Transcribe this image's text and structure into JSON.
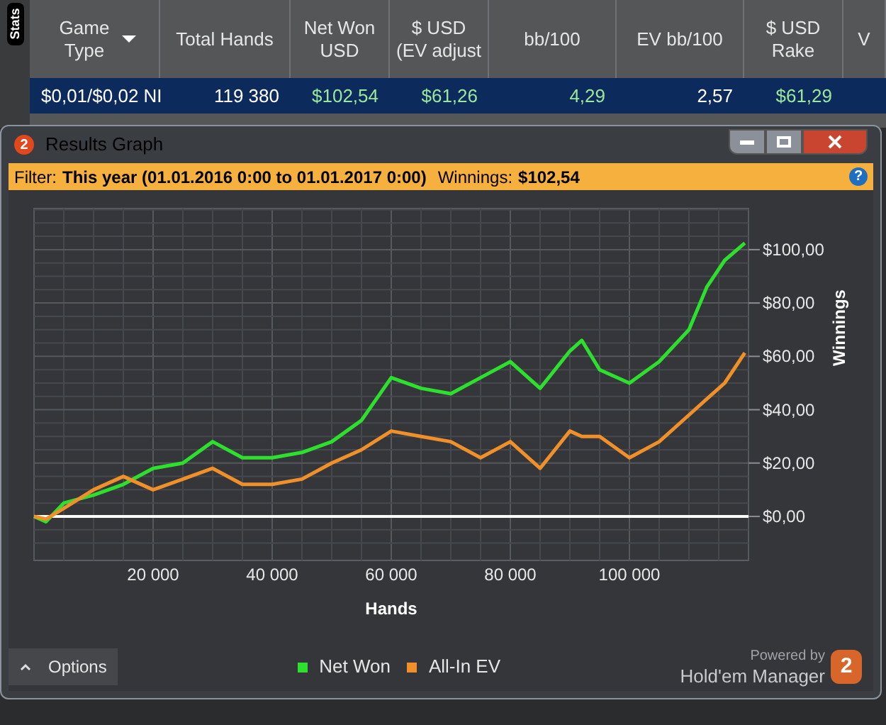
{
  "side_tab": {
    "label": "Stats"
  },
  "table": {
    "columns": [
      {
        "label": "Game Type",
        "menu": true
      },
      {
        "label": "Total Hands",
        "menu": false
      },
      {
        "label": "Net Won USD",
        "menu": false
      },
      {
        "label": "$ USD (EV adjust",
        "menu": false
      },
      {
        "label": "bb/100",
        "menu": false
      },
      {
        "label": "EV bb/100",
        "menu": false
      },
      {
        "label": "$ USD Rake",
        "menu": false
      },
      {
        "label": "V",
        "menu": false
      }
    ],
    "rows": [
      {
        "selected": true,
        "cells": [
          {
            "text": "$0,01/$0,02 NI",
            "color": "#ffffff"
          },
          {
            "text": "119 380",
            "color": "#ffffff"
          },
          {
            "text": "$102,54",
            "color": "#9be89b"
          },
          {
            "text": "$61,26",
            "color": "#9be89b"
          },
          {
            "text": "4,29",
            "color": "#9be89b"
          },
          {
            "text": "2,57",
            "color": "#ffffff"
          },
          {
            "text": "$61,29",
            "color": "#9be89b"
          }
        ]
      }
    ]
  },
  "window": {
    "logo": "2",
    "title": "Results Graph"
  },
  "filter": {
    "label": "Filter:",
    "value": "This year (01.01.2016 0:00 to 01.01.2017 0:00)",
    "winnings_label": "Winnings:",
    "winnings_value": "$102,54",
    "help": "?"
  },
  "chart_data": {
    "type": "line",
    "grid": true,
    "xlabel": "Hands",
    "ylabel": "Winnings",
    "x": [
      0,
      2000,
      5000,
      10000,
      15000,
      20000,
      25000,
      30000,
      35000,
      40000,
      45000,
      50000,
      55000,
      60000,
      65000,
      70000,
      75000,
      80000,
      85000,
      90000,
      92000,
      95000,
      100000,
      105000,
      110000,
      113000,
      116000,
      119380
    ],
    "series": [
      {
        "name": "Net Won",
        "color": "#2ee02e",
        "values": [
          0,
          -2,
          5,
          8,
          12,
          18,
          20,
          28,
          22,
          22,
          24,
          28,
          36,
          52,
          48,
          46,
          52,
          58,
          48,
          62,
          66,
          55,
          50,
          58,
          70,
          86,
          96,
          102.5
        ]
      },
      {
        "name": "All-In EV",
        "color": "#f0902a",
        "values": [
          0,
          -1,
          3,
          10,
          15,
          10,
          14,
          18,
          12,
          12,
          14,
          20,
          25,
          32,
          30,
          28,
          22,
          28,
          18,
          32,
          30,
          30,
          22,
          28,
          38,
          44,
          50,
          61.3
        ]
      }
    ],
    "xlim": [
      0,
      120000
    ],
    "ylim": [
      -16.5,
      115.4
    ],
    "xticks": [
      {
        "value": 20000,
        "label": "20 000"
      },
      {
        "value": 40000,
        "label": "40 000"
      },
      {
        "value": 60000,
        "label": "60 000"
      },
      {
        "value": 80000,
        "label": "80 000"
      },
      {
        "value": 100000,
        "label": "100 000"
      }
    ],
    "yticks": [
      {
        "value": 0,
        "label": "$0,00"
      },
      {
        "value": 20,
        "label": "$20,00"
      },
      {
        "value": 40,
        "label": "$40,00"
      },
      {
        "value": 60,
        "label": "$60,00"
      },
      {
        "value": 80,
        "label": "$80,00"
      },
      {
        "value": 100,
        "label": "$100,00"
      }
    ]
  },
  "footer": {
    "options": "Options",
    "powered_by": "Powered by",
    "brand": "Hold'em Manager",
    "logo": "2"
  }
}
